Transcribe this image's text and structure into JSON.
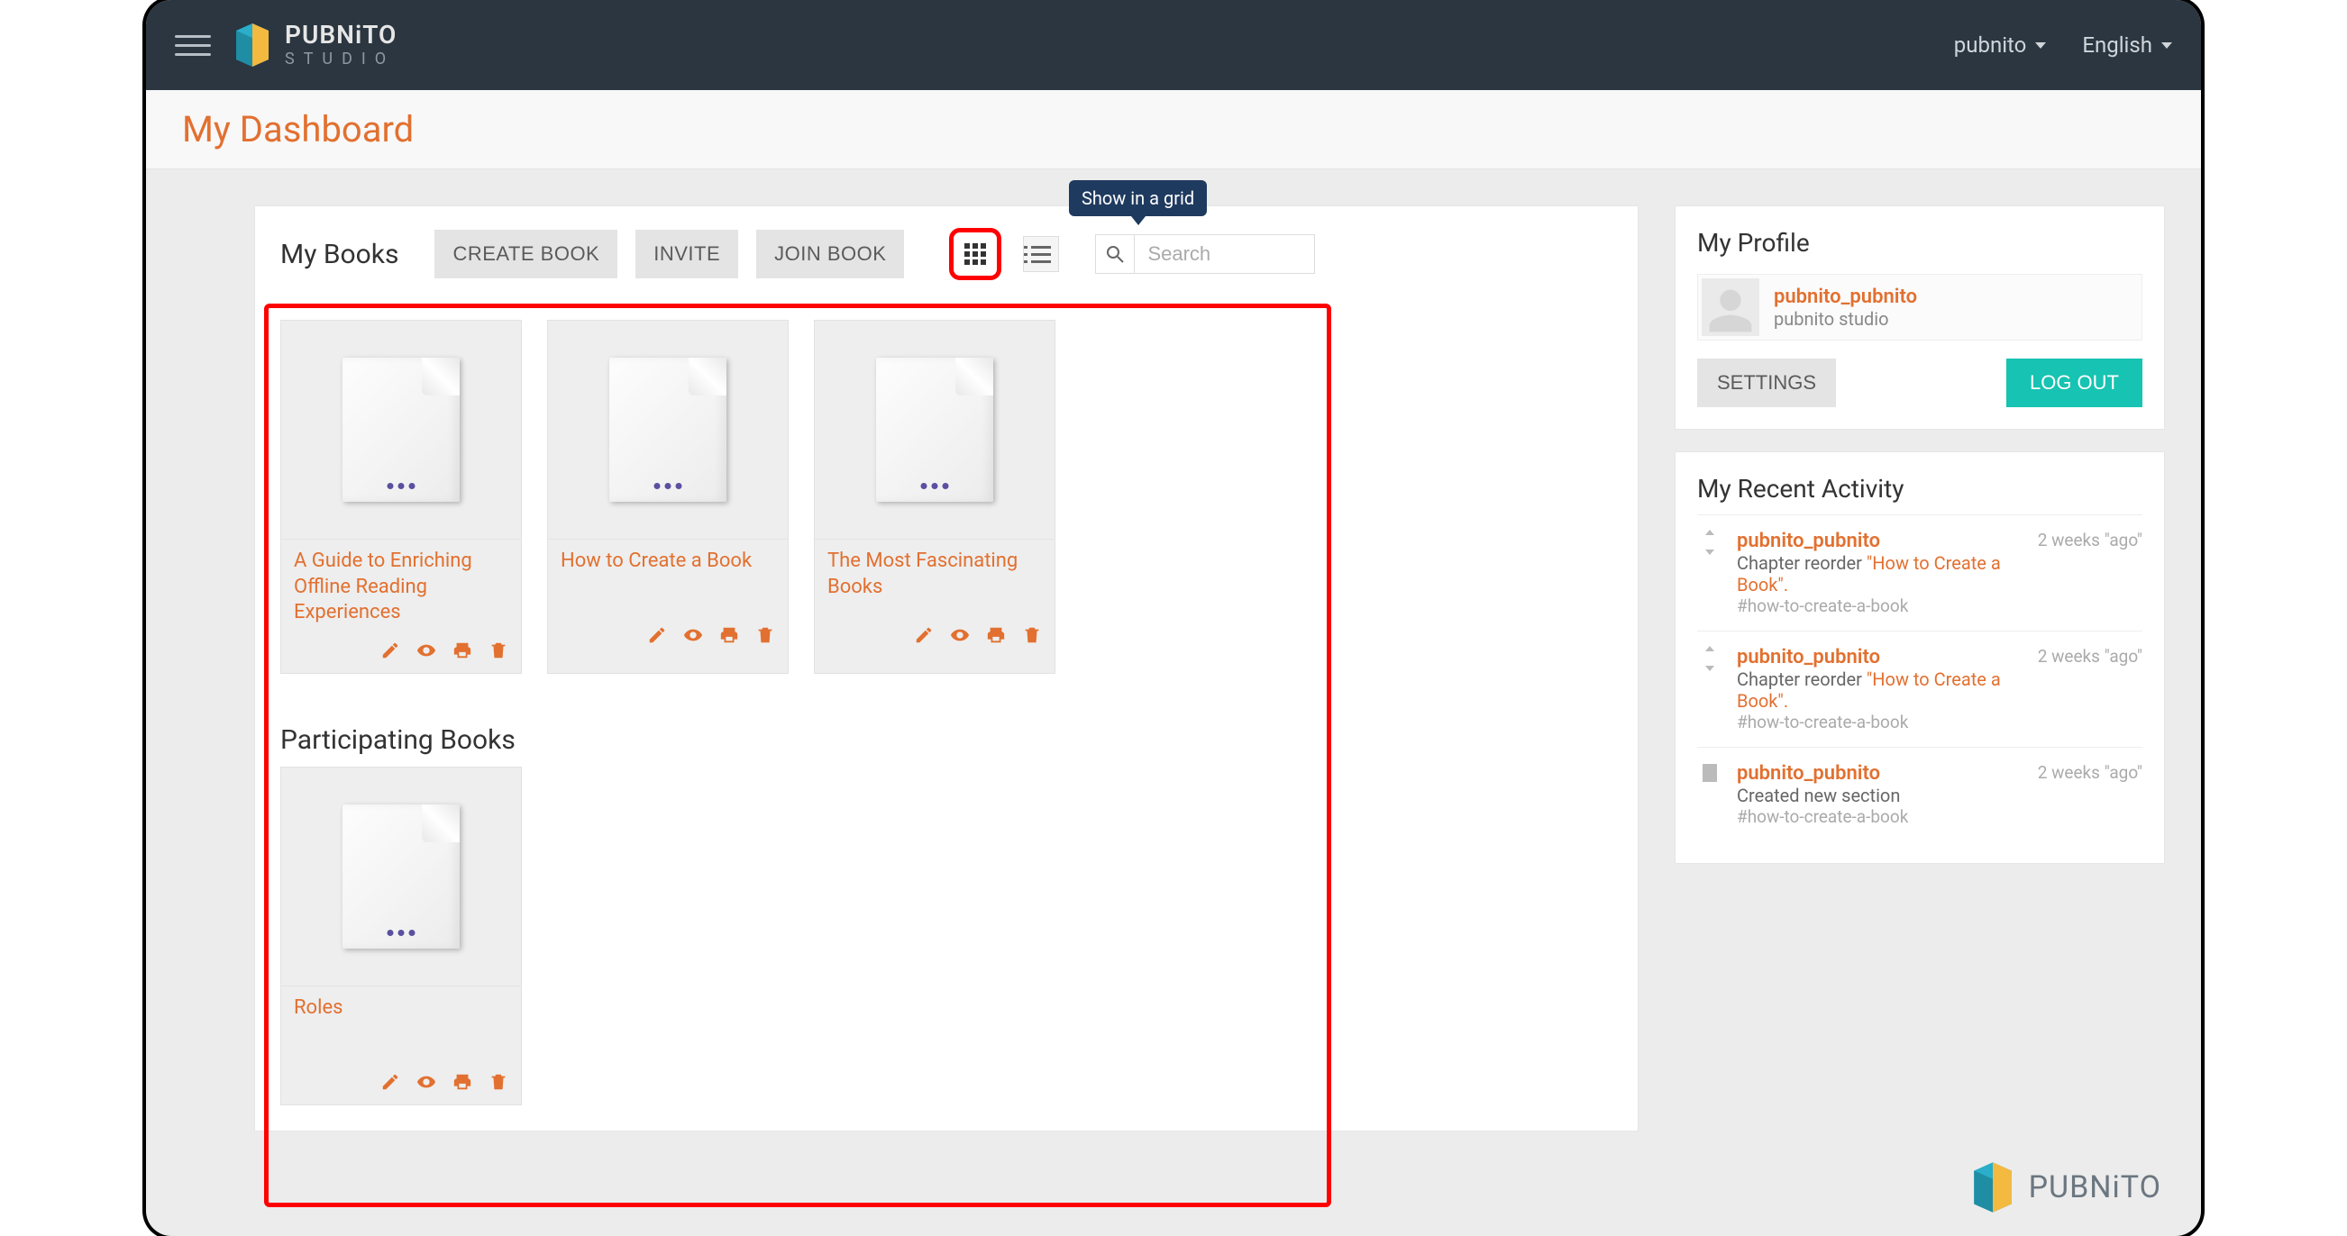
{
  "topbar": {
    "brand_main": "PUBNiTO",
    "brand_sub": "STUDIO",
    "user_dropdown": "pubnito",
    "lang_dropdown": "English"
  },
  "page_title": "My Dashboard",
  "tooltip_grid": "Show in a grid",
  "mybooks": {
    "title": "My Books",
    "create_btn": "CREATE BOOK",
    "invite_btn": "INVITE",
    "join_btn": "JOIN BOOK",
    "search_placeholder": "Search",
    "books": [
      {
        "title": "A Guide to Enriching Offline Reading Experiences"
      },
      {
        "title": "How to Create a Book"
      },
      {
        "title": "The Most Fascinating Books"
      }
    ]
  },
  "participating": {
    "title": "Participating Books",
    "books": [
      {
        "title": "Roles"
      }
    ]
  },
  "profile": {
    "title": "My Profile",
    "username": "pubnito_pubnito",
    "subtitle": "pubnito studio",
    "settings_btn": "SETTINGS",
    "logout_btn": "LOG OUT"
  },
  "activity": {
    "title": "My Recent Activity",
    "items": [
      {
        "icon": "reorder",
        "user": "pubnito_pubnito",
        "time": "2 weeks \"ago\"",
        "text_prefix": "Chapter reorder ",
        "link": "\"How to Create a Book\".",
        "hash": "#how-to-create-a-book"
      },
      {
        "icon": "reorder",
        "user": "pubnito_pubnito",
        "time": "2 weeks \"ago\"",
        "text_prefix": "Chapter reorder ",
        "link": "\"How to Create a Book\".",
        "hash": "#how-to-create-a-book"
      },
      {
        "icon": "section",
        "user": "pubnito_pubnito",
        "time": "2 weeks \"ago\"",
        "text_prefix": "Created new section",
        "link": "",
        "hash": "#how-to-create-a-book"
      }
    ]
  },
  "footer_brand": "PUBNiTO"
}
